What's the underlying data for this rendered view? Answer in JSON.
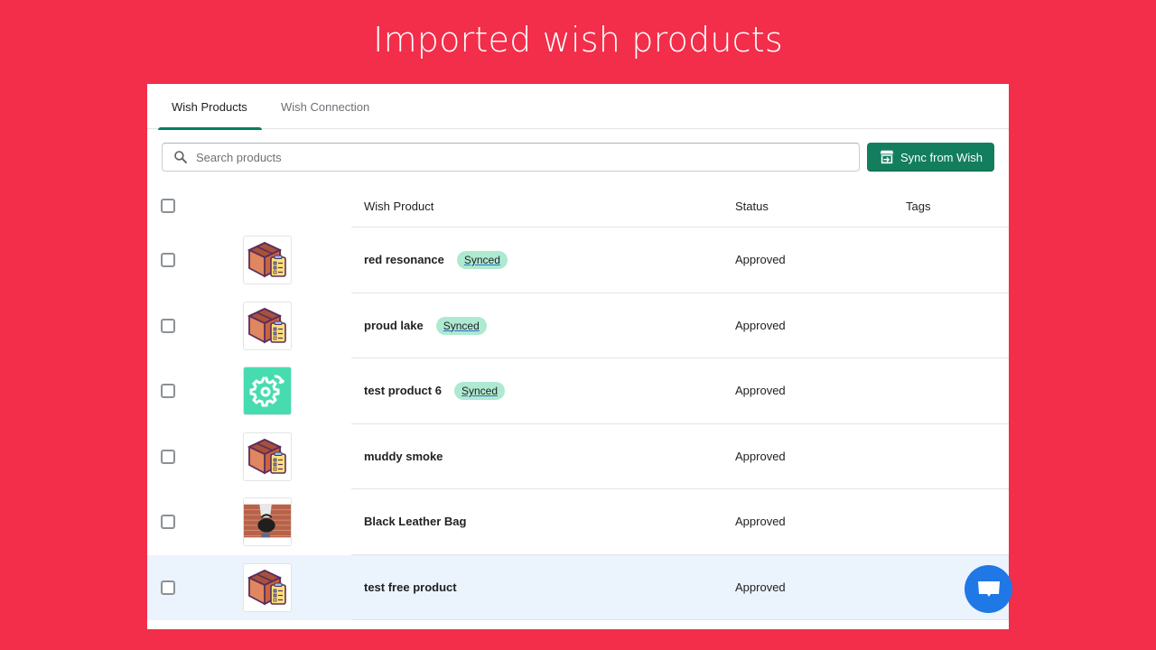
{
  "banner": {
    "title": "Imported wish products"
  },
  "tabs": [
    {
      "label": "Wish Products",
      "active": true
    },
    {
      "label": "Wish Connection",
      "active": false
    }
  ],
  "search": {
    "placeholder": "Search products",
    "value": ""
  },
  "sync_button": {
    "label": "Sync from Wish",
    "icon": "store-import-icon"
  },
  "table": {
    "headers": {
      "product": "Wish Product",
      "status": "Status",
      "tags": "Tags"
    },
    "rows": [
      {
        "name": "red resonance",
        "badge": "Synced",
        "status": "Approved",
        "tags": "",
        "thumb": "box-clipboard"
      },
      {
        "name": "proud lake",
        "badge": "Synced",
        "status": "Approved",
        "tags": "",
        "thumb": "box-clipboard"
      },
      {
        "name": "test product 6",
        "badge": "Synced",
        "status": "Approved",
        "tags": "",
        "thumb": "gear-sync"
      },
      {
        "name": "muddy smoke",
        "badge": "",
        "status": "Approved",
        "tags": "",
        "thumb": "box-clipboard"
      },
      {
        "name": "Black Leather Bag",
        "badge": "",
        "status": "Approved",
        "tags": "",
        "thumb": "photo-bag"
      },
      {
        "name": "test free product",
        "badge": "",
        "status": "Approved",
        "tags": "",
        "thumb": "box-clipboard",
        "highlighted": true
      }
    ]
  },
  "colors": {
    "background": "#f22e4a",
    "primary": "#137e5e",
    "badge": "#aee9d1",
    "chat": "#1f78e6",
    "row_highlight": "#ebf3fc"
  },
  "chat": {
    "icon": "chat-bubble-icon"
  }
}
